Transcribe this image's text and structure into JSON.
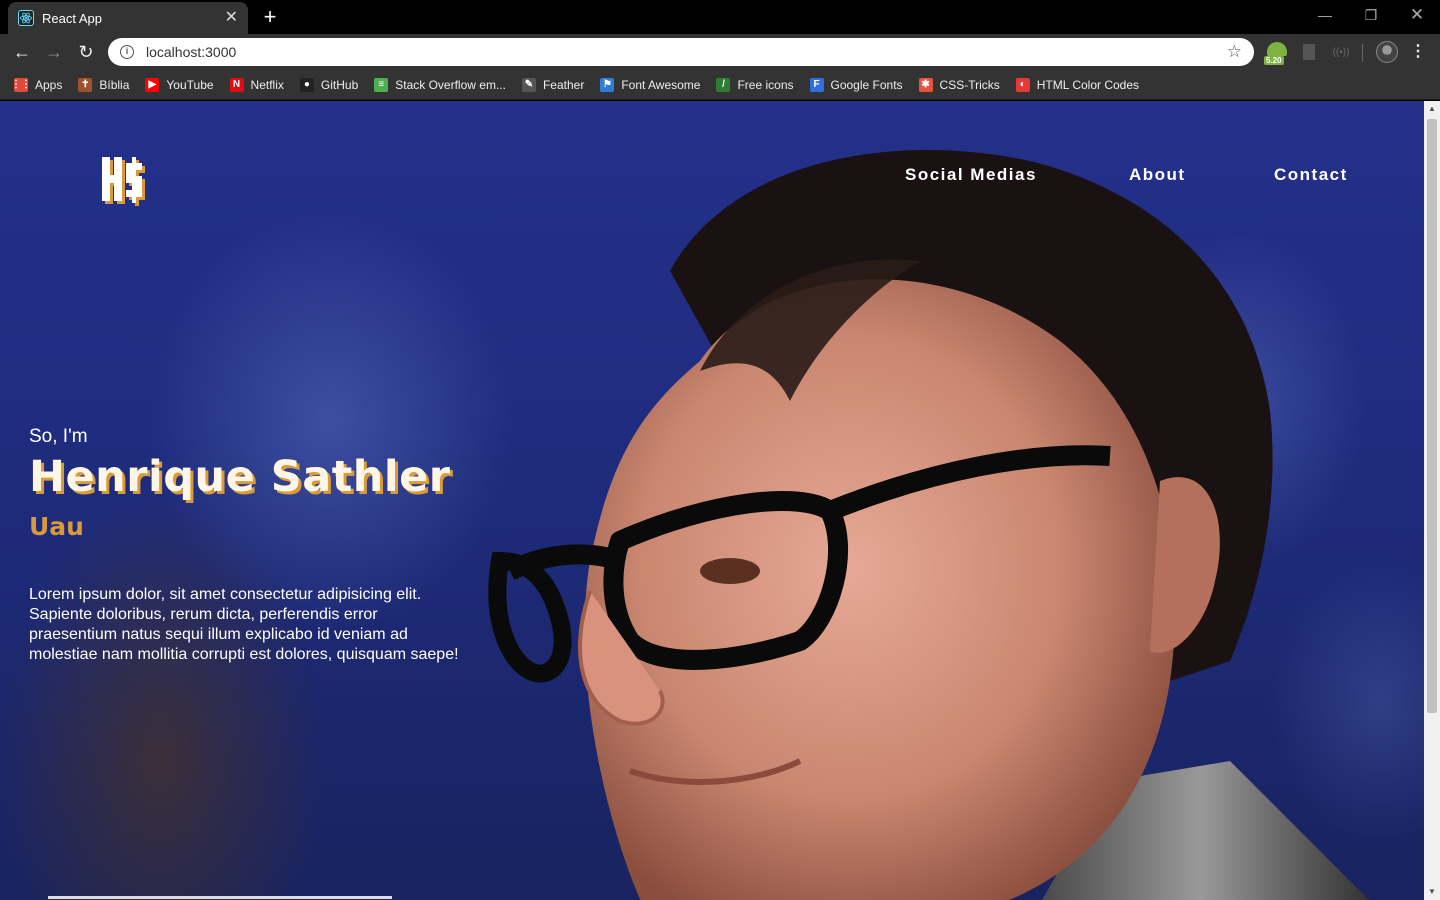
{
  "browser": {
    "tab_title": "React App",
    "url": "localhost:3000",
    "extension_badge": "5.20",
    "bookmarks": [
      {
        "label": "Apps",
        "icon": "apps-grid-icon",
        "color": "#e04a3a"
      },
      {
        "label": "Bíblia",
        "icon": "bible-icon",
        "color": "#a0522d"
      },
      {
        "label": "YouTube",
        "icon": "youtube-icon",
        "color": "#ff0000"
      },
      {
        "label": "Netflix",
        "icon": "netflix-icon",
        "color": "#e50914"
      },
      {
        "label": "GitHub",
        "icon": "github-icon",
        "color": "#222222"
      },
      {
        "label": "Stack Overflow em...",
        "icon": "stackoverflow-icon",
        "color": "#4caf50"
      },
      {
        "label": "Feather",
        "icon": "feather-icon",
        "color": "#555555"
      },
      {
        "label": "Font Awesome",
        "icon": "font-awesome-icon",
        "color": "#2e7dd7"
      },
      {
        "label": "Free icons",
        "icon": "free-icons-icon",
        "color": "#2e7d32"
      },
      {
        "label": "Google Fonts",
        "icon": "google-fonts-icon",
        "color": "#2f6fe0"
      },
      {
        "label": "CSS-Tricks",
        "icon": "css-tricks-icon",
        "color": "#e8533f"
      },
      {
        "label": "HTML Color Codes",
        "icon": "html-color-codes-icon",
        "color": "#e53935"
      }
    ]
  },
  "site": {
    "logo_text": "H$",
    "nav": {
      "social": "Social Medias",
      "about": "About",
      "contact": "Contact"
    },
    "hero": {
      "greeting": "So, I'm",
      "name": "Henrique Sathler",
      "subtitle": "Uau",
      "bio": "Lorem ipsum dolor, sit amet consectetur adipisicing elit. Sapiente doloribus, rerum dicta, perferendis error praesentium natus sequi illum explicabo id veniam ad molestiae nam mollitia corrupti est dolores, quisquam saepe!"
    },
    "accent_color": "#d89a3a",
    "background_color": "#1f2c7e"
  }
}
